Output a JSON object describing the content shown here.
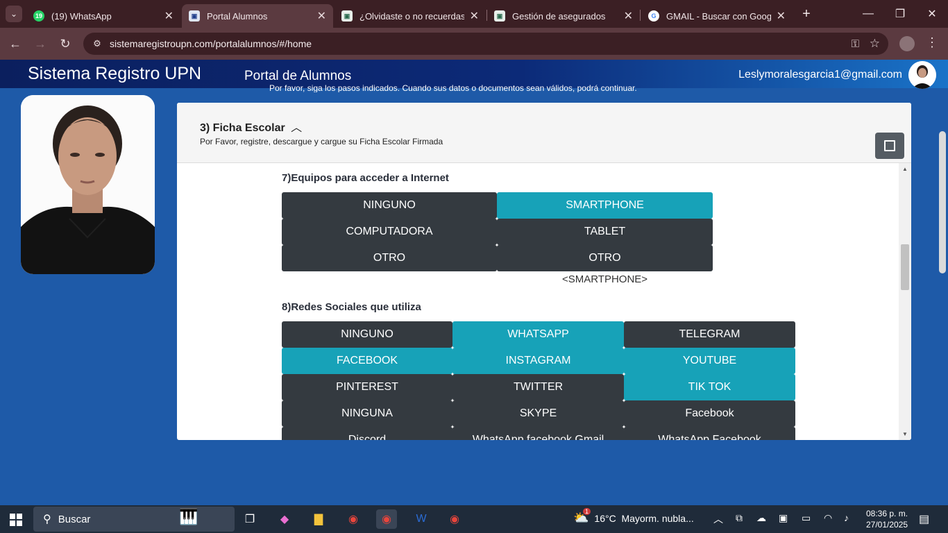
{
  "browser": {
    "tabs": [
      {
        "title": "(19) WhatsApp",
        "badge": "19"
      },
      {
        "title": "Portal Alumnos"
      },
      {
        "title": "¿Olvidaste o no recuerdas tu"
      },
      {
        "title": "Gestión de asegurados"
      },
      {
        "title": "GMAIL - Buscar con Google"
      }
    ],
    "url": "sistemaregistroupn.com/portalalumnos/#/home"
  },
  "header": {
    "title": "Sistema Registro UPN",
    "subtitle": "Portal de Alumnos",
    "email": "Leslymoralesgarcia1@gmail.com",
    "notice": "Por favor, siga los pasos indicados. Cuando sus datos o documentos sean válidos, podrá continuar."
  },
  "section": {
    "title": "3) Ficha Escolar",
    "description": "Por Favor, registre, descargue y cargue su Ficha Escolar Firmada"
  },
  "q7": {
    "title": "7)Equipos para acceder a Internet",
    "options": [
      "NINGUNO",
      "SMARTPHONE",
      "COMPUTADORA",
      "TABLET",
      "OTRO",
      "OTRO"
    ],
    "selected_text": "<SMARTPHONE>"
  },
  "q8": {
    "title": "8)Redes Sociales que utiliza",
    "options": [
      "NINGUNO",
      "WHATSAPP",
      "TELEGRAM",
      "FACEBOOK",
      "INSTAGRAM",
      "YOUTUBE",
      "PINTEREST",
      "TWITTER",
      "TIK TOK",
      "NINGUNA",
      "SKYPE",
      "Facebook",
      "Discord",
      "WhatsApp facebook Gmail",
      "WhatsApp Facebook"
    ]
  },
  "taskbar": {
    "search_placeholder": "Buscar",
    "weather": "16°C  Mayorm. nubla...",
    "weather_badge": "1",
    "time": "08:36 p. m.",
    "date": "27/01/2025"
  },
  "colors": {
    "selected": "#17a2b8",
    "unselected": "#343a40",
    "background": "#1e5aa8"
  }
}
